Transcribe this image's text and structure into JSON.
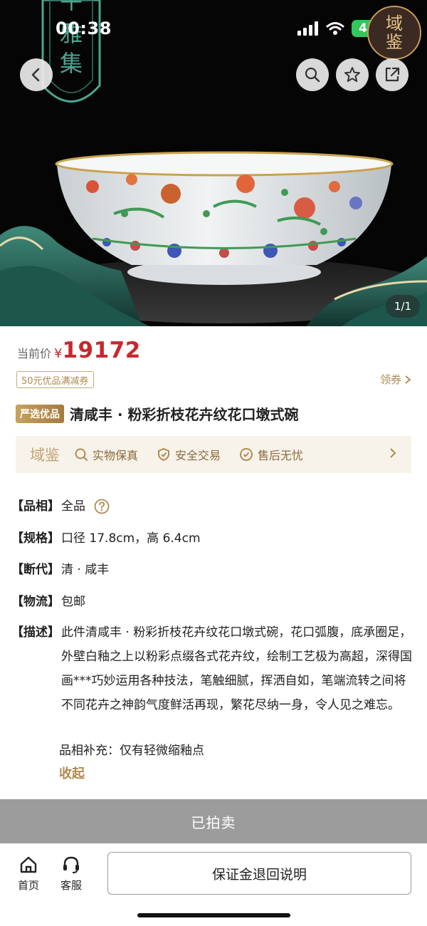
{
  "status_bar": {
    "time": "00:38",
    "battery": "41"
  },
  "hero": {
    "banner_chars": [
      "牛",
      "雅",
      "集"
    ],
    "seal_chars": [
      "域",
      "鉴"
    ],
    "page_indicator": "1/1"
  },
  "icons": {
    "back": "chevron-left-icon",
    "circular_a": "search-like-icon",
    "circular_b": "star-icon",
    "circular_c": "share-icon"
  },
  "price": {
    "label": "当前价",
    "currency": "¥",
    "value": "19172"
  },
  "coupon": {
    "badge": "50元优品满减券",
    "get": "领券",
    "get_arrow": ">"
  },
  "tag": "严选优品",
  "title": "清咸丰 · 粉彩折枝花卉纹花口墩式碗",
  "guarantee": {
    "brand": "域鉴",
    "items": [
      "实物保真",
      "安全交易",
      "售后无忧"
    ]
  },
  "attributes": [
    {
      "key": "【品相】",
      "value": "全品"
    },
    {
      "key": "【规格】",
      "value": "口径 17.8cm，高 6.4cm"
    },
    {
      "key": "【断代】",
      "value": "清 · 咸丰"
    },
    {
      "key": "【物流】",
      "value": "包邮"
    }
  ],
  "description": {
    "key": "【描述】",
    "text": "此件清咸丰 · 粉彩折枝花卉纹花口墩式碗，花口弧腹，底承圈足，外壁白釉之上以粉彩点缀各式花卉纹，绘制工艺极为高超，深得国画***巧妙运用各种技法，笔触细腻，挥洒自如，笔端流转之间将不同花卉之神韵气度鲜活再现，繁花尽纳一身，令人见之难忘。",
    "supplement": "品相补充：仅有轻微缩釉点",
    "collapse": "收起"
  },
  "sold": "已拍卖",
  "tabbar": {
    "home": "首页",
    "service": "客服",
    "deposit": "保证金退回说明"
  },
  "colors": {
    "price": "#c8282d",
    "gold": "#b08a52",
    "sold": "#9c9c9c"
  }
}
